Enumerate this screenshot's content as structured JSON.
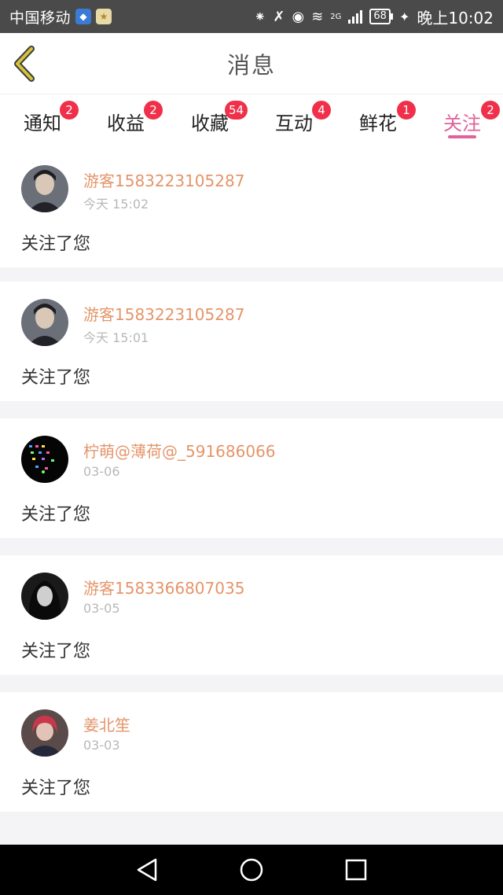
{
  "status_bar": {
    "carrier": "中国移动",
    "network_type": "2G",
    "battery": "68",
    "time": "晚上10:02"
  },
  "header": {
    "title": "消息",
    "back_icon": "chevron-left-icon",
    "accent_color": "#c9b033"
  },
  "tabs": [
    {
      "label": "通知",
      "badge": "2"
    },
    {
      "label": "收益",
      "badge": "2"
    },
    {
      "label": "收藏",
      "badge": "54"
    },
    {
      "label": "互动",
      "badge": "4"
    },
    {
      "label": "鲜花",
      "badge": "1"
    },
    {
      "label": "关注",
      "badge": "2",
      "active": true
    }
  ],
  "colors": {
    "active_tab": "#e0619b",
    "badge": "#f0304a",
    "username": "#e4956a"
  },
  "messages": [
    {
      "username": "游客1583223105287",
      "time": "今天 15:02",
      "text": "关注了您"
    },
    {
      "username": "游客1583223105287",
      "time": "今天 15:01",
      "text": "关注了您"
    },
    {
      "username": "柠萌@薄荷@_591686066",
      "time": "03-06",
      "text": "关注了您"
    },
    {
      "username": "游客1583366807035",
      "time": "03-05",
      "text": "关注了您"
    },
    {
      "username": "姜北笙",
      "time": "03-03",
      "text": "关注了您"
    }
  ],
  "nav_bar": {
    "back": "back-triangle-icon",
    "home": "home-circle-icon",
    "recents": "recents-square-icon"
  }
}
